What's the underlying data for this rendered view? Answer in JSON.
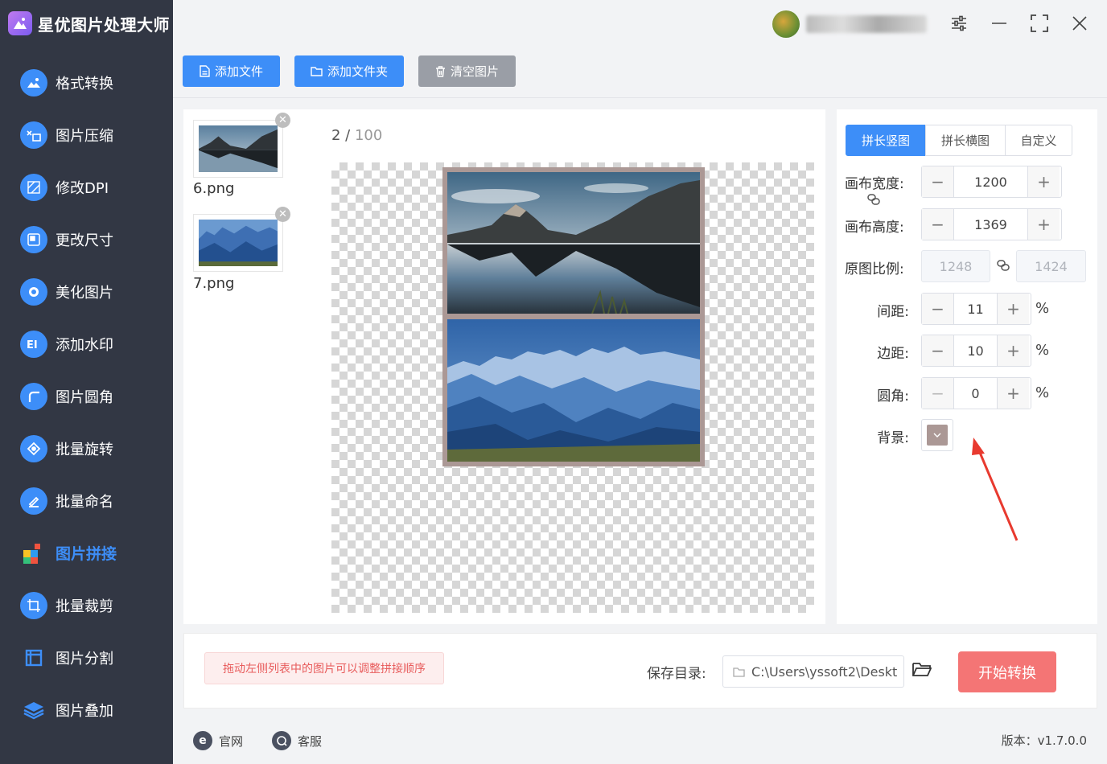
{
  "app": {
    "title": "星优图片处理大师"
  },
  "sidebar": {
    "items": [
      {
        "label": "格式转换",
        "icon": "image-convert-icon",
        "color": "#3d8ef8"
      },
      {
        "label": "图片压缩",
        "icon": "compress-icon",
        "color": "#3d8ef8"
      },
      {
        "label": "修改DPI",
        "icon": "dpi-icon",
        "color": "#3d8ef8"
      },
      {
        "label": "更改尺寸",
        "icon": "resize-icon",
        "color": "#3d8ef8"
      },
      {
        "label": "美化图片",
        "icon": "beautify-icon",
        "color": "#3d8ef8"
      },
      {
        "label": "添加水印",
        "icon": "watermark-icon",
        "color": "#3d8ef8"
      },
      {
        "label": "图片圆角",
        "icon": "round-corner-icon",
        "color": "#3d8ef8"
      },
      {
        "label": "批量旋转",
        "icon": "rotate-icon",
        "color": "#3d8ef8"
      },
      {
        "label": "批量命名",
        "icon": "rename-icon",
        "color": "#3d8ef8"
      },
      {
        "label": "图片拼接",
        "icon": "puzzle-icon",
        "color": "#3d8ef8",
        "active": true
      },
      {
        "label": "批量裁剪",
        "icon": "crop-icon",
        "color": "#3d8ef8"
      },
      {
        "label": "图片分割",
        "icon": "split-icon",
        "color": "#3d8ef8"
      },
      {
        "label": "图片叠加",
        "icon": "layers-icon",
        "color": "#3d8ef8"
      }
    ]
  },
  "toolbar": {
    "add_file": "添加文件",
    "add_folder": "添加文件夹",
    "clear": "清空图片"
  },
  "files": [
    {
      "name": "6.png"
    },
    {
      "name": "7.png"
    }
  ],
  "preview": {
    "current": "2",
    "separator": " / ",
    "total": "100",
    "background_color": "#ab9895"
  },
  "settings": {
    "tabs": [
      "拼长竖图",
      "拼长横图",
      "自定义"
    ],
    "active_tab": "拼长竖图",
    "canvas_width_label": "画布宽度:",
    "canvas_width": "1200",
    "canvas_height_label": "画布高度:",
    "canvas_height": "1369",
    "ratio_label": "原图比例:",
    "ratio_w": "1248",
    "ratio_h": "1424",
    "spacing_label": "间距:",
    "spacing": "11",
    "margin_label": "边距:",
    "margin": "10",
    "radius_label": "圆角:",
    "radius": "0",
    "percent": "%",
    "background_label": "背景:"
  },
  "bottom": {
    "hint": "拖动左侧列表中的图片可以调整拼接顺序",
    "save_label": "保存目录:",
    "save_path": "C:\\Users\\yssoft2\\Deskt",
    "start": "开始转换"
  },
  "footer": {
    "website": "官网",
    "support": "客服",
    "version": "版本：v1.7.0.0"
  },
  "colors": {
    "accent": "#3d8ef8",
    "sidebar_bg": "#323744",
    "start_button": "#f47575",
    "hint_text": "#e85c5c"
  }
}
